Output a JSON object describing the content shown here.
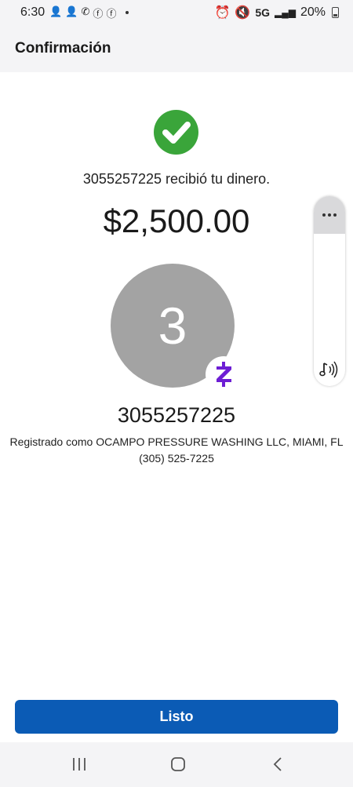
{
  "status_bar": {
    "time": "6:30",
    "network": "5G",
    "battery": "20%",
    "left_icons": [
      "person-add-icon",
      "person-add-icon",
      "phone-icon",
      "facebook-icon",
      "facebook-icon"
    ],
    "right_icons": [
      "alarm-icon",
      "mute-icon",
      "signal-icon",
      "battery-icon"
    ]
  },
  "header": {
    "title": "Confirmación"
  },
  "confirmation": {
    "message": "3055257225 recibió tu dinero.",
    "amount": "$2,500.00",
    "avatar_letter": "3",
    "recipient": "3055257225",
    "registered_as": "Registrado como OCAMPO PRESSURE WASHING LLC, MIAMI, FL",
    "phone": "(305) 525-7225"
  },
  "actions": {
    "done_label": "Listo"
  },
  "colors": {
    "success": "#3aa53a",
    "primary_button": "#0b5bb5",
    "zelle_purple": "#6d1ed4",
    "avatar_gray": "#a3a3a3",
    "header_bg": "#f4f4f6"
  }
}
